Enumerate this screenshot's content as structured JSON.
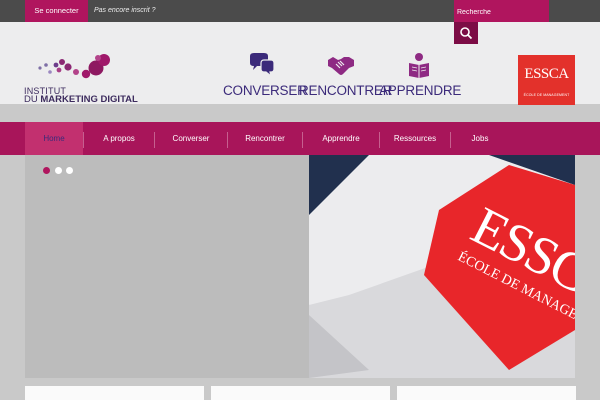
{
  "topbar": {
    "login_label": "Se connecter",
    "signup_text": "Pas encore inscrit ?",
    "search_placeholder": "Recherche"
  },
  "header": {
    "logo": {
      "line1": "INSTITUT",
      "line2_prefix": "DU ",
      "line2_bold": "MARKETING DIGITAL"
    },
    "features": [
      {
        "label": "CONVERSER",
        "icon": "chat-bubbles-icon"
      },
      {
        "label": "RENCONTRER",
        "icon": "handshake-icon"
      },
      {
        "label": "APPRENDRE",
        "icon": "reading-person-icon"
      }
    ],
    "partner_logo": {
      "name": "ESSCA",
      "subtitle": "ÉCOLE DE MANAGEMENT"
    }
  },
  "nav": {
    "items": [
      {
        "label": "Home",
        "active": true
      },
      {
        "label": "A propos"
      },
      {
        "label": "Converser"
      },
      {
        "label": "Rencontrer"
      },
      {
        "label": "Apprendre"
      },
      {
        "label": "Ressources"
      },
      {
        "label": "Jobs"
      }
    ]
  },
  "slider": {
    "dots": 3,
    "active_dot": 0,
    "hero_sign": {
      "brand": "ESSCA",
      "line": "ÉCOLE DE MANAGEMENT"
    }
  },
  "colors": {
    "primary": "#a8155a",
    "accent": "#b0155e",
    "purple": "#3b2a7a",
    "essca_red": "#e3312b"
  }
}
